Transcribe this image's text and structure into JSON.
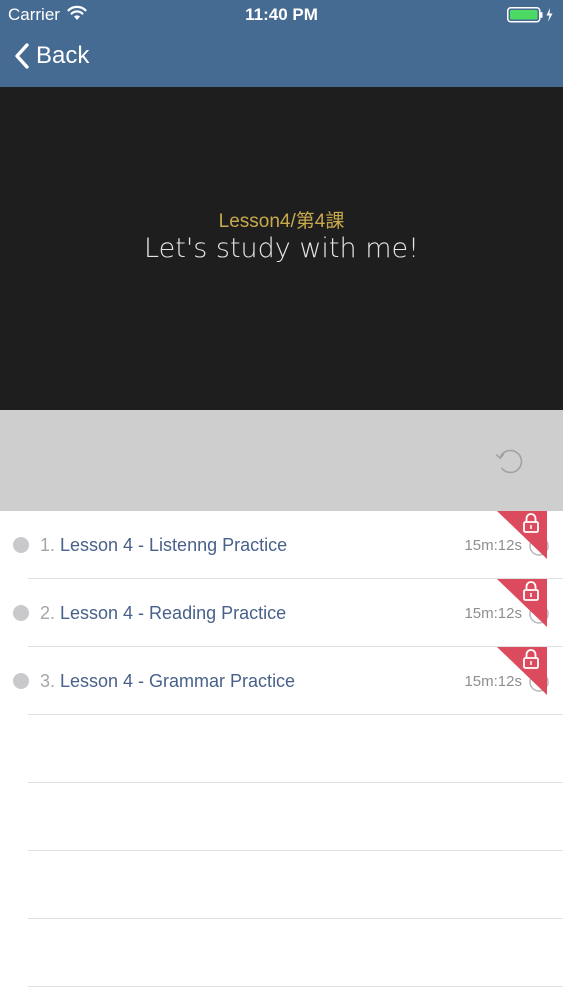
{
  "status_bar": {
    "carrier": "Carrier",
    "time": "11:40 PM",
    "battery_color": "#4cd964"
  },
  "nav": {
    "back_label": "Back",
    "background_color": "#466b93"
  },
  "video": {
    "lesson_code": "Lesson4/第4課",
    "title": "Let's study with me!",
    "code_color": "#c8a94b"
  },
  "controls": {
    "replay_icon": "replay-icon"
  },
  "lessons": [
    {
      "index": "1.",
      "title": "Lesson 4 - Listenng Practice",
      "duration": "15m:12s",
      "locked": true
    },
    {
      "index": "2.",
      "title": "Lesson 4 - Reading Practice",
      "duration": "15m:12s",
      "locked": true
    },
    {
      "index": "3.",
      "title": "Lesson 4 - Grammar Practice",
      "duration": "15m:12s",
      "locked": true
    }
  ],
  "lock_badge_color": "#dc4a5e"
}
